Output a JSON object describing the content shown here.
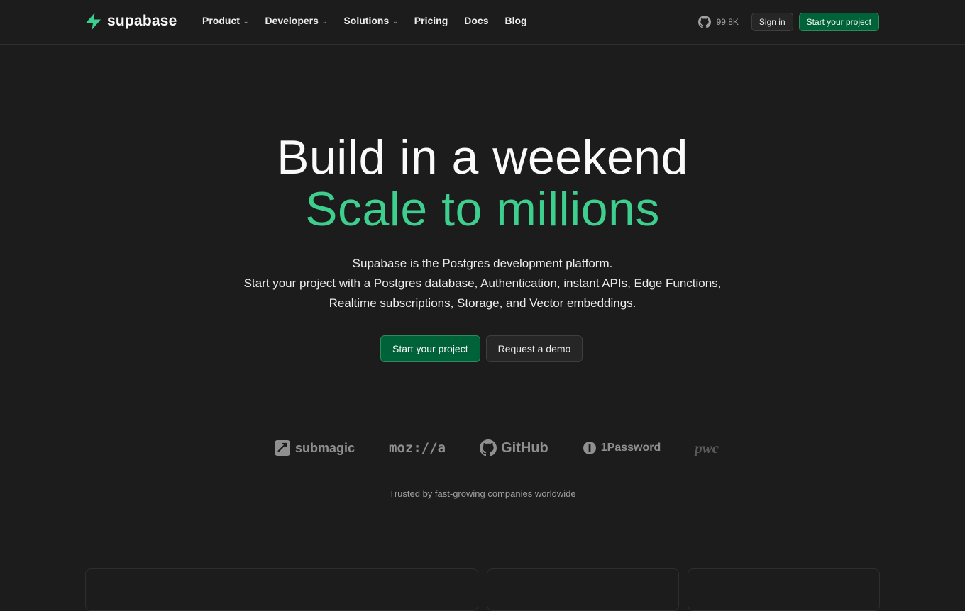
{
  "nav": {
    "logo_text": "supabase",
    "menu": [
      {
        "label": "Product",
        "has_dropdown": true
      },
      {
        "label": "Developers",
        "has_dropdown": true
      },
      {
        "label": "Solutions",
        "has_dropdown": true
      },
      {
        "label": "Pricing",
        "has_dropdown": false
      },
      {
        "label": "Docs",
        "has_dropdown": false
      },
      {
        "label": "Blog",
        "has_dropdown": false
      }
    ],
    "github_stars": "99.8K",
    "sign_in": "Sign in",
    "start_project": "Start your project"
  },
  "hero": {
    "line1": "Build in a weekend",
    "line2": "Scale to millions",
    "sub1": "Supabase is the Postgres development platform.",
    "sub2": "Start your project with a Postgres database, Authentication, instant APIs, Edge Functions, Realtime subscriptions, Storage, and Vector embeddings.",
    "cta_primary": "Start your project",
    "cta_secondary": "Request a demo"
  },
  "logos": {
    "submagic": "submagic",
    "mozilla": "moz://a",
    "github": "GitHub",
    "onepassword": "1Password",
    "pwc": "pwc"
  },
  "trusted": "Trusted by fast-growing companies worldwide",
  "colors": {
    "background": "#1c1c1c",
    "brand_green": "#3ecf8e",
    "button_green": "#006239"
  }
}
